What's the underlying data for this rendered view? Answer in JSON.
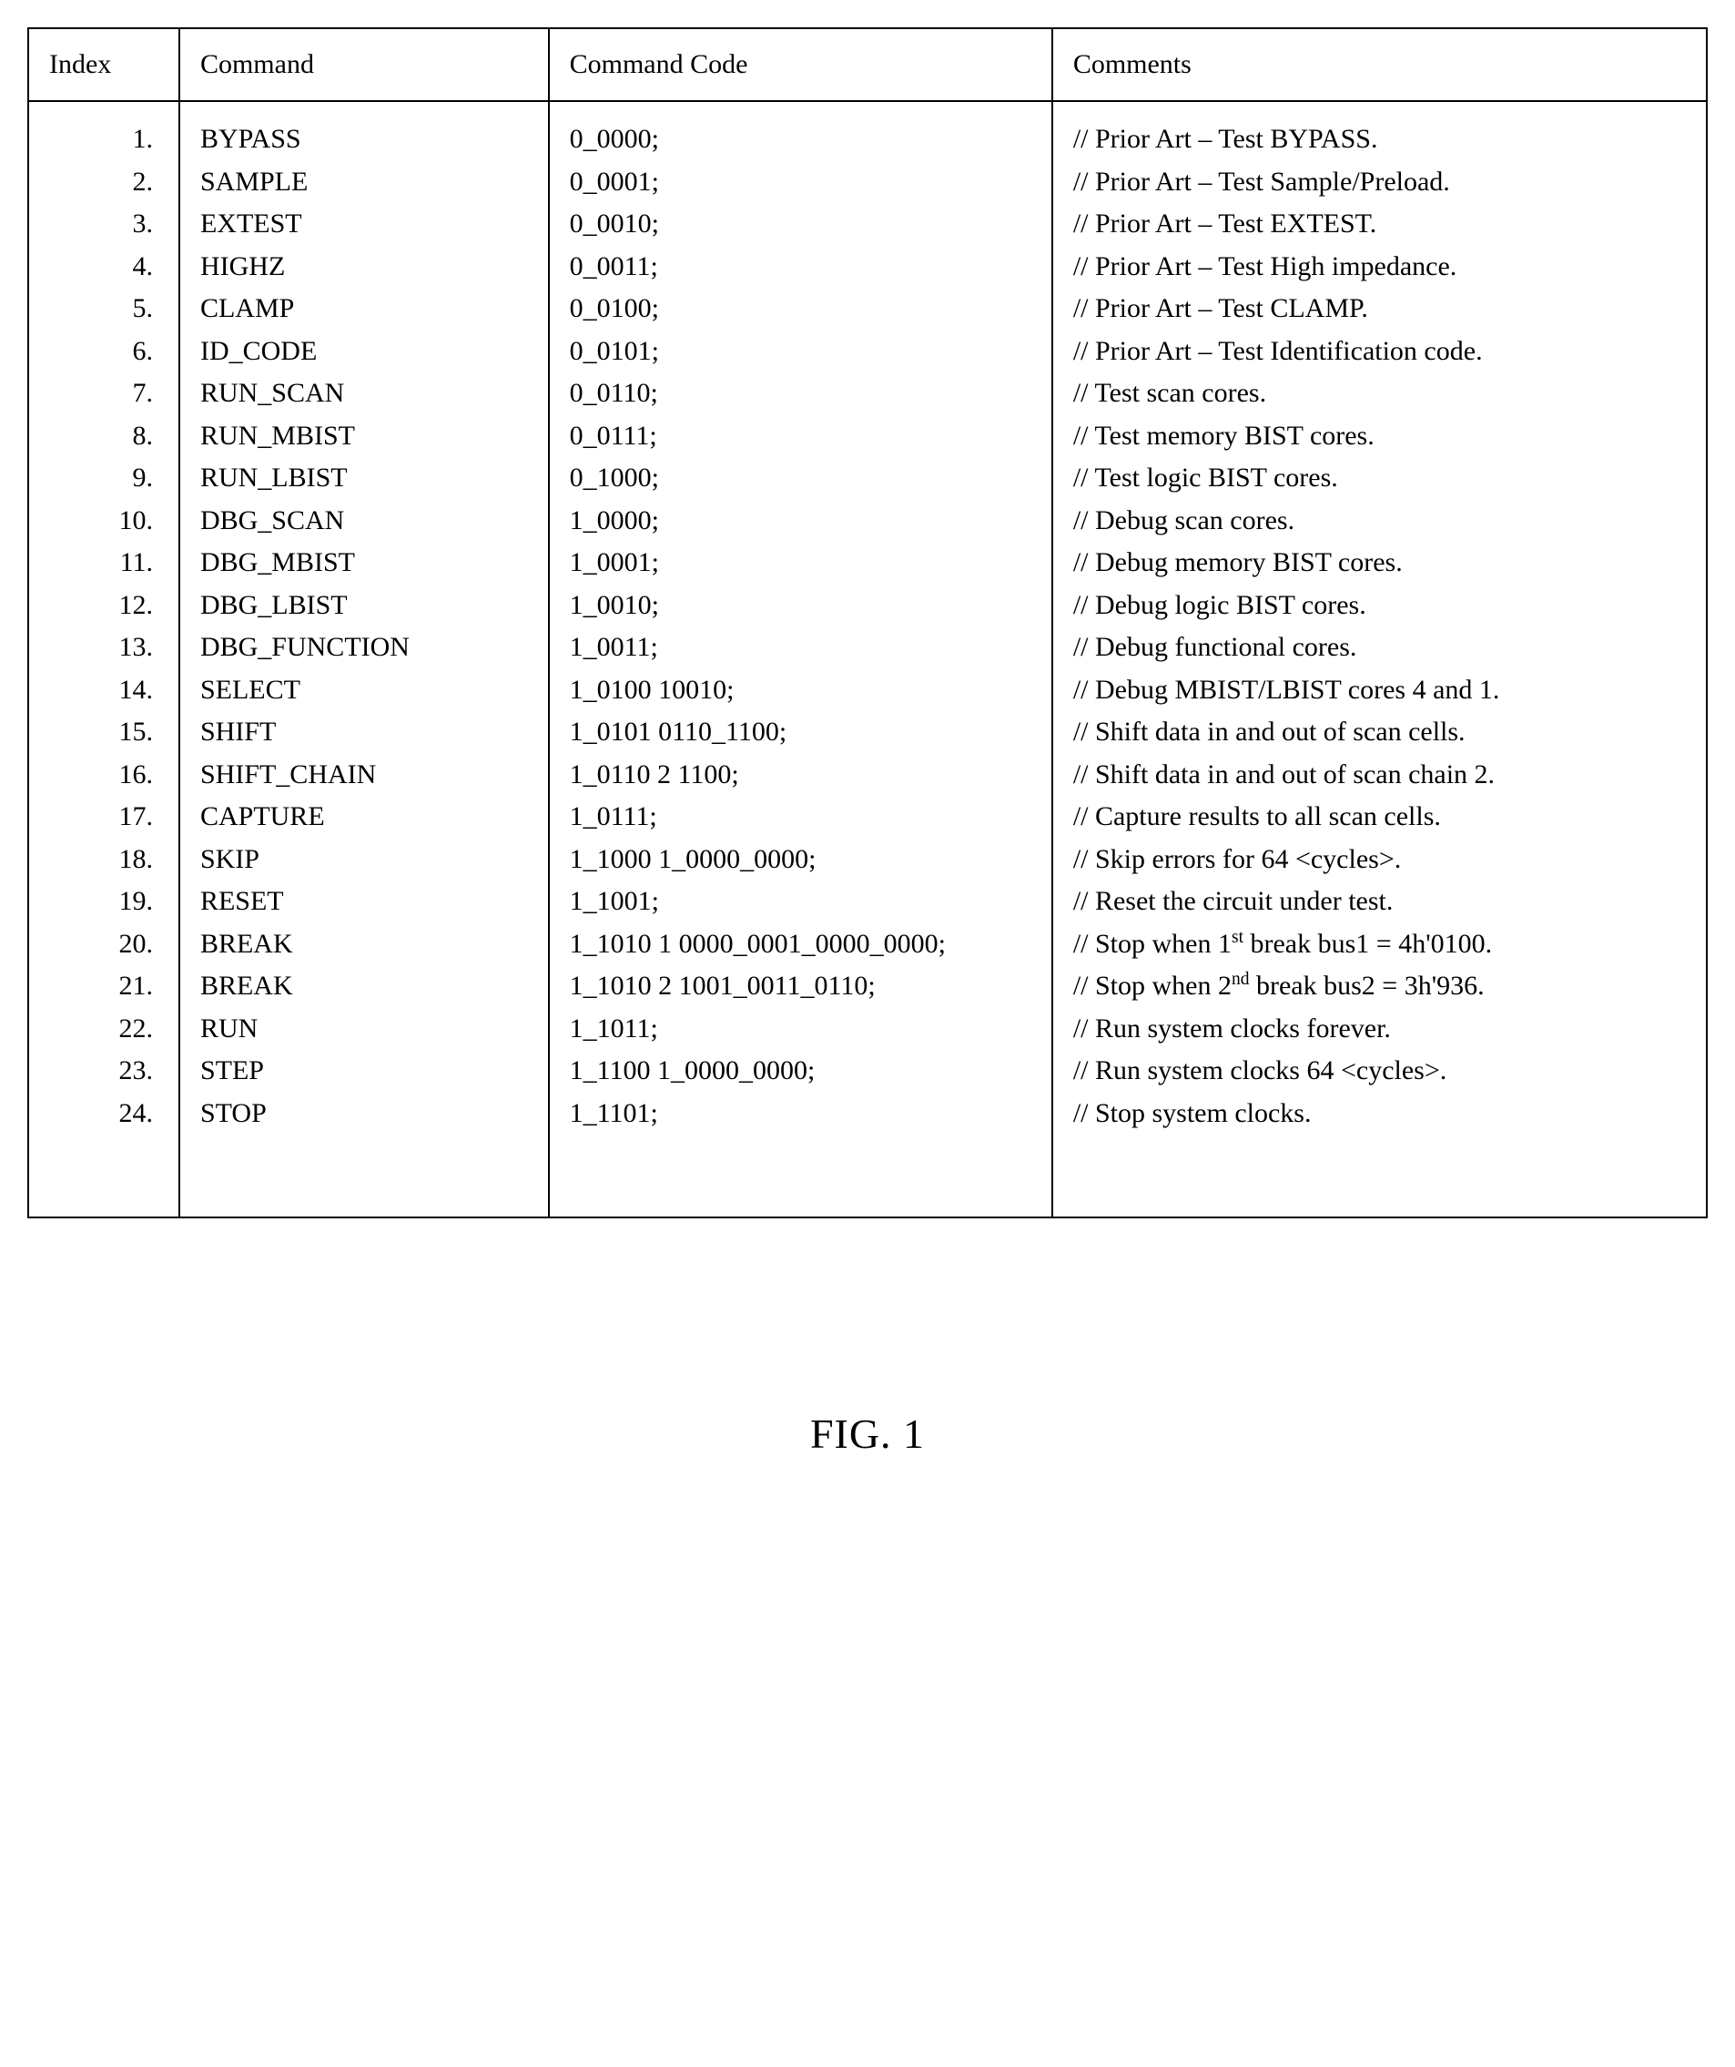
{
  "table": {
    "headers": {
      "index": "Index",
      "command": "Command",
      "code": "Command Code",
      "comments": "Comments"
    },
    "rows": [
      {
        "index": "1.",
        "command": "BYPASS",
        "code": "0_0000;",
        "comment": "// Prior Art – Test BYPASS."
      },
      {
        "index": "2.",
        "command": "SAMPLE",
        "code": "0_0001;",
        "comment": "// Prior Art – Test Sample/Preload."
      },
      {
        "index": "3.",
        "command": "EXTEST",
        "code": "0_0010;",
        "comment": "// Prior Art – Test EXTEST."
      },
      {
        "index": "4.",
        "command": "HIGHZ",
        "code": "0_0011;",
        "comment": "// Prior Art – Test High impedance."
      },
      {
        "index": "5.",
        "command": "CLAMP",
        "code": "0_0100;",
        "comment": "// Prior Art – Test CLAMP."
      },
      {
        "index": "6.",
        "command": "ID_CODE",
        "code": "0_0101;",
        "comment": "// Prior Art – Test Identification code."
      },
      {
        "index": "7.",
        "command": "RUN_SCAN",
        "code": "0_0110;",
        "comment": "// Test scan cores."
      },
      {
        "index": "8.",
        "command": "RUN_MBIST",
        "code": "0_0111;",
        "comment": "// Test memory BIST cores."
      },
      {
        "index": "9.",
        "command": "RUN_LBIST",
        "code": "0_1000;",
        "comment": "// Test logic BIST cores."
      },
      {
        "index": "10.",
        "command": "DBG_SCAN",
        "code": "1_0000;",
        "comment": "// Debug scan cores."
      },
      {
        "index": "11.",
        "command": "DBG_MBIST",
        "code": "1_0001;",
        "comment": "// Debug memory BIST cores."
      },
      {
        "index": "12.",
        "command": "DBG_LBIST",
        "code": "1_0010;",
        "comment": "// Debug logic BIST cores."
      },
      {
        "index": "13.",
        "command": "DBG_FUNCTION",
        "code": "1_0011;",
        "comment": "// Debug functional cores."
      },
      {
        "index": "14.",
        "command": "SELECT",
        "code": "1_0100 10010;",
        "comment": "// Debug MBIST/LBIST cores 4 and 1."
      },
      {
        "index": "15.",
        "command": "SHIFT",
        "code": "1_0101 0110_1100;",
        "comment": "// Shift data in and out of scan cells."
      },
      {
        "index": "16.",
        "command": "SHIFT_CHAIN",
        "code": "1_0110 2 1100;",
        "comment": "// Shift data in and out of scan chain 2."
      },
      {
        "index": "17.",
        "command": "CAPTURE",
        "code": "1_0111;",
        "comment": "// Capture results to all scan cells."
      },
      {
        "index": "18.",
        "command": "SKIP",
        "code": "1_1000 1_0000_0000;",
        "comment": "// Skip errors for 64 <cycles>."
      },
      {
        "index": "19.",
        "command": "RESET",
        "code": "1_1001;",
        "comment": "// Reset the circuit under test."
      },
      {
        "index": "20.",
        "command": "BREAK",
        "code": "1_1010 1 0000_0001_0000_0000;",
        "comment_html": "// Stop when 1<sup>st</sup> break bus1 = 4h'0100."
      },
      {
        "index": "21.",
        "command": "BREAK",
        "code": "1_1010 2 1001_0011_0110;",
        "comment_html": "// Stop when 2<sup>nd</sup> break bus2 = 3h'936."
      },
      {
        "index": "22.",
        "command": "RUN",
        "code": "1_1011;",
        "comment": "// Run system clocks forever."
      },
      {
        "index": "23.",
        "command": "STEP",
        "code": "1_1100 1_0000_0000;",
        "comment": "// Run system clocks 64 <cycles>."
      },
      {
        "index": "24.",
        "command": "STOP",
        "code": "1_1101;",
        "comment": "// Stop system clocks."
      }
    ]
  },
  "figure_caption": "FIG. 1"
}
